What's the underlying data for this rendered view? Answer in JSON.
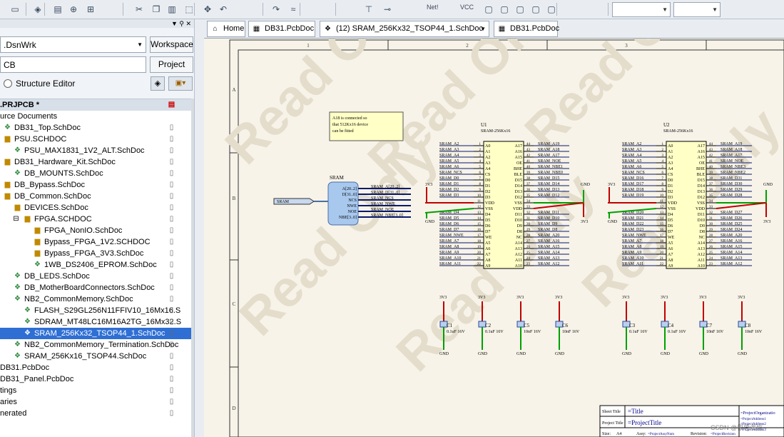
{
  "toolbar": {
    "icons": [
      "folder-icon",
      "save-icon",
      "print-icon",
      "zoom-icon",
      "zoom-fit-icon",
      "cut-icon",
      "copy-icon",
      "paste-icon",
      "select-icon",
      "move-icon",
      "undo-icon",
      "redo-icon",
      "wire-icon",
      "bus-icon",
      "port-icon"
    ],
    "labels": {
      "net": "Net!",
      "vcc": "VCC"
    }
  },
  "panel": {
    "workspace_field": ".DsnWrk",
    "workspace_button": "Workspace",
    "project_field": "CB",
    "project_button": "Project",
    "structure_editor": "Structure Editor",
    "items": [
      {
        "label": ".PRJPCB *",
        "type": "header",
        "indent": 0
      },
      {
        "label": "urce Documents",
        "type": "text",
        "indent": 0
      },
      {
        "label": "DB31_Top.SchDoc",
        "type": "sch",
        "indent": 0
      },
      {
        "label": "PSU.SCHDOC",
        "type": "folder",
        "indent": 0
      },
      {
        "label": "PSU_MAX1831_1V2_ALT.SchDoc",
        "type": "sch",
        "indent": 1
      },
      {
        "label": "DB31_Hardware_Kit.SchDoc",
        "type": "folder",
        "indent": 0
      },
      {
        "label": "DB_MOUNTS.SchDoc",
        "type": "sch",
        "indent": 1
      },
      {
        "label": "DB_Bypass.SchDoc",
        "type": "folder",
        "indent": 0
      },
      {
        "label": "DB_Common.SchDoc",
        "type": "folder",
        "indent": 0
      },
      {
        "label": "DEVICES.SchDoc",
        "type": "folder",
        "indent": 1
      },
      {
        "label": "FPGA.SCHDOC",
        "type": "folder",
        "indent": 2
      },
      {
        "label": "FPGA_NonIO.SchDoc",
        "type": "folder",
        "indent": 3
      },
      {
        "label": "Bypass_FPGA_1V2.SCHDOC",
        "type": "folder",
        "indent": 3
      },
      {
        "label": "Bypass_FPGA_3V3.SchDoc",
        "type": "folder",
        "indent": 3
      },
      {
        "label": "1WB_DS2406_EPROM.SchDoc",
        "type": "sch",
        "indent": 3
      },
      {
        "label": "DB_LEDS.SchDoc",
        "type": "sch",
        "indent": 1
      },
      {
        "label": "DB_MotherBoardConnectors.SchDoc",
        "type": "sch",
        "indent": 1
      },
      {
        "label": "NB2_CommonMemory.SchDoc",
        "type": "sch",
        "indent": 1
      },
      {
        "label": "FLASH_S29GL256N11FFIV10_16Mx16.S",
        "type": "sch",
        "indent": 2
      },
      {
        "label": "SDRAM_MT48LC16M16A2TG_16Mx32.S",
        "type": "sch",
        "indent": 2
      },
      {
        "label": "SRAM_256Kx32_TSOP44_1.SchDoc",
        "type": "sch",
        "indent": 2,
        "selected": true
      },
      {
        "label": "NB2_CommonMemory_Termination.SchDoc",
        "type": "sch",
        "indent": 1
      },
      {
        "label": "SRAM_256Kx16_TSOP44.SchDoc",
        "type": "sch",
        "indent": 1
      },
      {
        "label": "DB31.PcbDoc",
        "type": "text",
        "indent": 0
      },
      {
        "label": "DB31_Panel.PcbDoc",
        "type": "text",
        "indent": 0
      },
      {
        "label": "tings",
        "type": "text",
        "indent": 0
      },
      {
        "label": "aries",
        "type": "text",
        "indent": 0
      },
      {
        "label": "nerated",
        "type": "text",
        "indent": 0
      }
    ]
  },
  "tabs": [
    {
      "label": "Home",
      "icon": "home-icon"
    },
    {
      "label": "DB31.PcbDoc",
      "icon": "pcb-icon"
    },
    {
      "label": "(12) SRAM_256Kx32_TSOP44_1.SchDoc",
      "icon": "schematic-icon"
    },
    {
      "label": "DB31.PcbDoc",
      "icon": "pcb-icon"
    }
  ],
  "schematic": {
    "columns": [
      "1",
      "2",
      "3"
    ],
    "rows": [
      "A",
      "B",
      "C",
      "D"
    ],
    "watermark": "Read Only",
    "note": [
      "A18 is connected so",
      "that 512Kx16 device",
      "can be fitted"
    ],
    "sheet_symbol": {
      "title": "SRAM",
      "port": "SRAM",
      "entries": [
        "A[20..2]",
        "D[31..0]",
        "NCS",
        "NWE",
        "NOE",
        "NBE[3..0]"
      ],
      "nets": [
        "SRAM_A[20..2]",
        "SRAM_D[31..0]",
        "SRAM_NCS",
        "SRAM_NWE",
        "SRAM_NOE",
        "SRAM_NBE[3..0]"
      ]
    },
    "u1": {
      "ref": "U1",
      "part": "SRAM-256Kx16",
      "lpins": [
        "A0",
        "A1",
        "A2",
        "A3",
        "A4",
        "CS",
        "D0",
        "D1",
        "D2",
        "D3",
        "VDD",
        "VSS",
        "D4",
        "D5",
        "D6",
        "D7",
        "WE",
        "A5",
        "A6",
        "A7",
        "A8",
        "A9"
      ],
      "lnums": [
        "1",
        "2",
        "3",
        "4",
        "5",
        "6",
        "7",
        "8",
        "9",
        "10",
        "11",
        "12",
        "13",
        "14",
        "15",
        "16",
        "17",
        "18",
        "19",
        "20",
        "21",
        "22"
      ],
      "lnets": [
        "SRAM_A2",
        "SRAM_A3",
        "SRAM_A4",
        "SRAM_A5",
        "SRAM_A6",
        "SRAM_NCS",
        "SRAM_D0",
        "SRAM_D1",
        "SRAM_D2",
        "SRAM_D3",
        "",
        "",
        "SRAM_D4",
        "SRAM_D5",
        "SRAM_D6",
        "SRAM_D7",
        "SRAM_NWE",
        "SRAM_A7",
        "SRAM_A8",
        "SRAM_A9",
        "SRAM_A10",
        "SRAM_A11"
      ],
      "rpins": [
        "A17",
        "A16",
        "A15",
        "OE",
        "BHE",
        "BLE",
        "D15",
        "D14",
        "D13",
        "D12",
        "VSS",
        "VDD",
        "D11",
        "D10",
        "D9",
        "D8",
        "NC",
        "A14",
        "A13",
        "A12",
        "A11",
        "A10"
      ],
      "rnums": [
        "44",
        "43",
        "42",
        "41",
        "40",
        "39",
        "38",
        "37",
        "36",
        "35",
        "34",
        "33",
        "32",
        "31",
        "30",
        "29",
        "28",
        "27",
        "26",
        "25",
        "24",
        "23"
      ],
      "rnets": [
        "SRAM_A19",
        "SRAM_A18",
        "SRAM_A17",
        "SRAM_NOE",
        "SRAM_NBE1",
        "SRAM_NBE0",
        "SRAM_D15",
        "SRAM_D14",
        "SRAM_D13",
        "SRAM_D12",
        "",
        "",
        "SRAM_D11",
        "SRAM_D10",
        "SRAM_D9",
        "SRAM_D8",
        "SRAM_A20",
        "SRAM_A16",
        "SRAM_A15",
        "SRAM_A14",
        "SRAM_A13",
        "SRAM_A12"
      ]
    },
    "u2": {
      "ref": "U2",
      "part": "SRAM-256Kx16",
      "lnets": [
        "SRAM_A2",
        "SRAM_A3",
        "SRAM_A4",
        "SRAM_A5",
        "SRAM_A6",
        "SRAM_NCS",
        "SRAM_D16",
        "SRAM_D17",
        "SRAM_D18",
        "SRAM_D19",
        "",
        "",
        "SRAM_D20",
        "SRAM_D21",
        "SRAM_D22",
        "SRAM_D23",
        "SRAM_NWE",
        "SRAM_A7",
        "SRAM_A8",
        "SRAM_A9",
        "SRAM_A10",
        "SRAM_A11"
      ],
      "rnets": [
        "SRAM_A19",
        "SRAM_A18",
        "SRAM_A17",
        "SRAM_NOE",
        "SRAM_NBE3",
        "SRAM_NBE2",
        "SRAM_D31",
        "SRAM_D30",
        "SRAM_D29",
        "SRAM_D28",
        "",
        "",
        "SRAM_D27",
        "SRAM_D26",
        "SRAM_D25",
        "SRAM_D24",
        "SRAM_A20",
        "SRAM_A16",
        "SRAM_A15",
        "SRAM_A14",
        "SRAM_A13",
        "SRAM_A12"
      ]
    },
    "power": {
      "v33": "3V3",
      "gnd": "GND"
    },
    "caps": [
      {
        "ref": "C1",
        "value": "0.1uF 16V"
      },
      {
        "ref": "C2",
        "value": "0.1uF 16V"
      },
      {
        "ref": "C5",
        "value": "10nF 16V"
      },
      {
        "ref": "C6",
        "value": "10nF 16V"
      },
      {
        "ref": "C3",
        "value": "0.1uF 16V"
      },
      {
        "ref": "C4",
        "value": "0.1uF 16V"
      },
      {
        "ref": "C7",
        "value": "10nF 16V"
      },
      {
        "ref": "C8",
        "value": "10nF 16V"
      }
    ],
    "title_block": {
      "sheet_title_label": "Sheet Title",
      "sheet_title": "=Title",
      "project_title_label": "Project Title",
      "project_title": "=ProjectTitle",
      "size_label": "Size:",
      "size": "A4",
      "assy_label": "Assy:",
      "assy": "=ProjectAssyNum",
      "revision_label": "Revision:",
      "revision": "=ProjectRevision",
      "org": "=ProjectOrganizatio",
      "addr1": "=ProjectAddress1",
      "addr2": "=ProjectAddress2",
      "addr3": "=ProjectAddress3"
    },
    "csdn": "CSDN @根管海稻"
  }
}
